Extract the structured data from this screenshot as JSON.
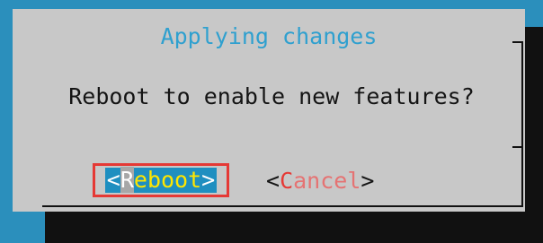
{
  "dialog": {
    "title": "Applying changes",
    "message": "Reboot to enable new features?"
  },
  "buttons": {
    "reboot": {
      "open_bracket": "<",
      "hotkey": "R",
      "rest": "eboot",
      "close_bracket": ">",
      "highlighted": true
    },
    "cancel": {
      "open_bracket": "<",
      "hotkey": "C",
      "rest": "ancel",
      "close_bracket": ">"
    }
  },
  "colors": {
    "background": "#2b8fbc",
    "dialog": "#c8c8c8",
    "title": "#2fa0cf",
    "highlight_box": "#e53935",
    "selected_text": "#ffe600"
  }
}
